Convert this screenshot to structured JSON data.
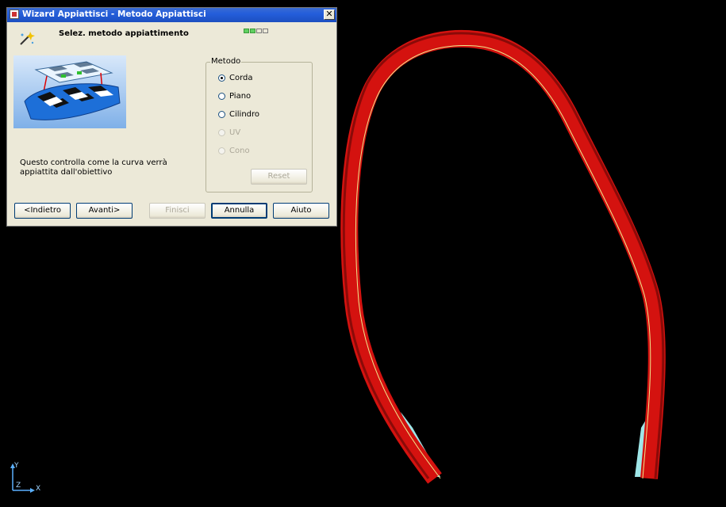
{
  "dialog": {
    "title": "Wizard Appiattisci - Metodo Appiattisci",
    "close_label": "✕",
    "header": "Selez. metodo appiattimento",
    "progress": {
      "total_steps": 4,
      "completed_steps": 2
    },
    "description": "Questo controlla come la curva verrà appiattita dall'obiettivo",
    "method_group": {
      "legend": "Metodo",
      "options": [
        {
          "label": "Corda",
          "checked": true,
          "enabled": true
        },
        {
          "label": "Piano",
          "checked": false,
          "enabled": true
        },
        {
          "label": "Cilindro",
          "checked": false,
          "enabled": true
        },
        {
          "label": "UV",
          "checked": false,
          "enabled": false
        },
        {
          "label": "Cono",
          "checked": false,
          "enabled": false
        }
      ],
      "reset_label": "Reset"
    },
    "buttons": {
      "back": "<Indietro",
      "next": "Avanti>",
      "finish": "Finisci",
      "cancel": "Annulla",
      "help": "Aiuto"
    }
  },
  "viewport": {
    "axis_labels": {
      "x": "X",
      "y": "Y",
      "z": "Z"
    },
    "curve_color": "#d4120f",
    "inner_curve_color": "#9fe6e8"
  }
}
